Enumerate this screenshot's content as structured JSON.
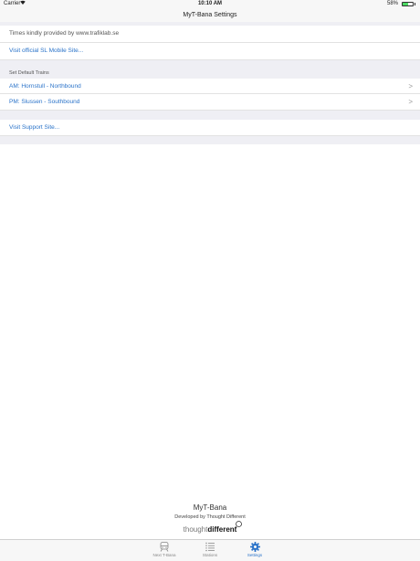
{
  "status_bar": {
    "carrier": "Carrier",
    "time": "10:10 AM",
    "battery": "58%",
    "battery_level": 0.58
  },
  "nav": {
    "title": "MyT-Bana Settings"
  },
  "info": {
    "credit": "Times kindly provided by www.trafiklab.se",
    "sl_link": "Visit official SL Mobile Site..."
  },
  "default_trains": {
    "header": "Set Default Trains",
    "am": "AM: Hornstull - Northbound",
    "pm": "PM: Slussen - Southbound",
    "chevron": ">"
  },
  "support": {
    "link": "Visit Support Site..."
  },
  "footer": {
    "app_name": "MyT-Bana",
    "developer": "Developed by Thought Different",
    "brand_thought": "thought",
    "brand_different": "different"
  },
  "tabs": [
    {
      "label": "Next T-Bana",
      "icon": "train-icon"
    },
    {
      "label": "Stations",
      "icon": "list-icon"
    },
    {
      "label": "Settings",
      "icon": "gear-icon"
    }
  ],
  "colors": {
    "accent": "#2a73c9",
    "group_bg": "#efeff4"
  }
}
